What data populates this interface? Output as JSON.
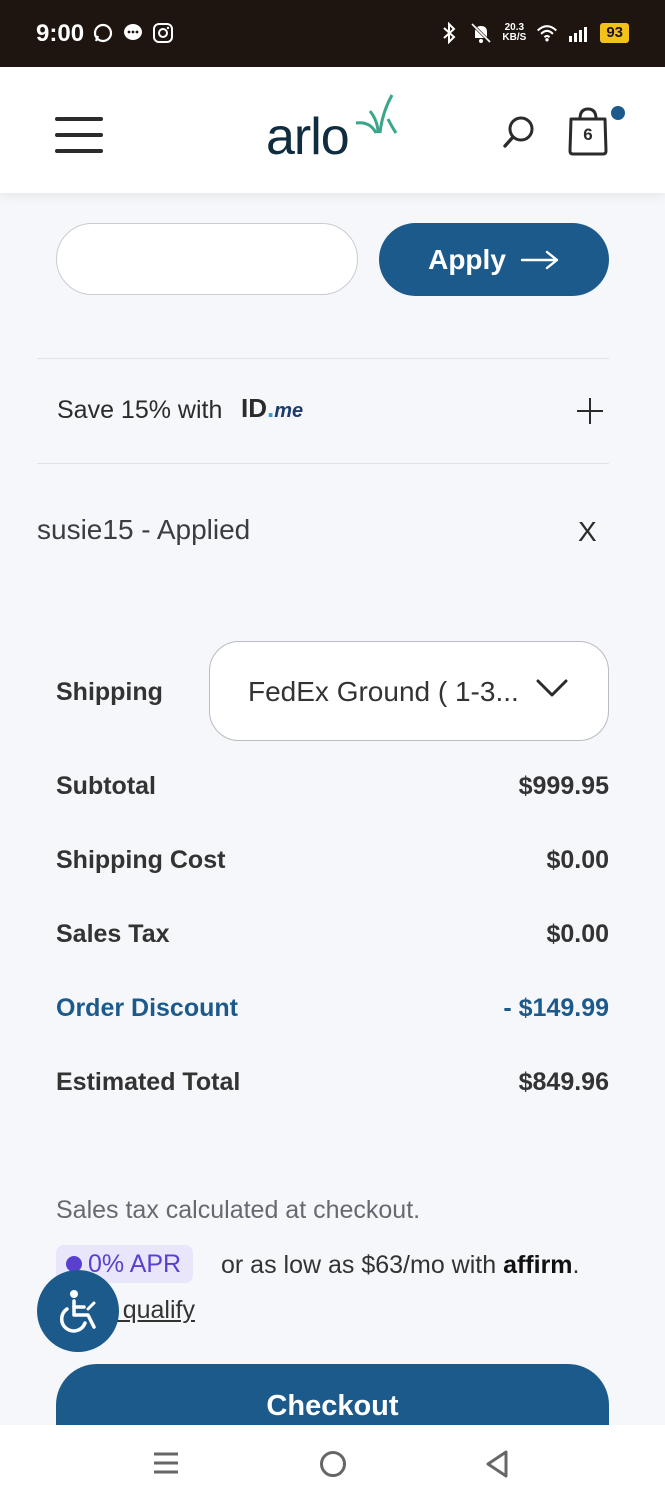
{
  "status_bar": {
    "time": "9:00",
    "net_speed_value": "20.3",
    "net_speed_unit": "KB/S",
    "battery": "93",
    "icons": [
      "whatsapp-icon",
      "chat-icon",
      "instagram-icon",
      "bluetooth-icon",
      "mute-icon",
      "wifi-icon",
      "signal-icon"
    ]
  },
  "header": {
    "logo_text": "arlo",
    "cart_count": "6",
    "colors": {
      "brand": "#1d5a8c",
      "logo_leaf": "#3aa58a"
    }
  },
  "promo": {
    "input_value": "",
    "apply_label": "Apply"
  },
  "idme": {
    "text": "Save 15% with",
    "logo_id": "ID",
    "logo_me": "me"
  },
  "applied_code": {
    "text": "susie15 - Applied",
    "remove_label": "X"
  },
  "shipping": {
    "label": "Shipping",
    "selected": "FedEx Ground ( 1-3..."
  },
  "summary": {
    "subtotal_label": "Subtotal",
    "subtotal_value": "$999.95",
    "shipping_cost_label": "Shipping Cost",
    "shipping_cost_value": "$0.00",
    "sales_tax_label": "Sales Tax",
    "sales_tax_value": "$0.00",
    "discount_label": "Order Discount",
    "discount_value": "- $149.99",
    "total_label": "Estimated Total",
    "total_value": "$849.96"
  },
  "footer": {
    "tax_note": "Sales tax calculated at checkout.",
    "apr_badge": "0% APR",
    "affirm_text": "or as low as $63/mo with",
    "affirm_brand": "affirm",
    "affirm_period": ".",
    "qualify_link": "if you qualify",
    "checkout_label": "Checkout"
  }
}
